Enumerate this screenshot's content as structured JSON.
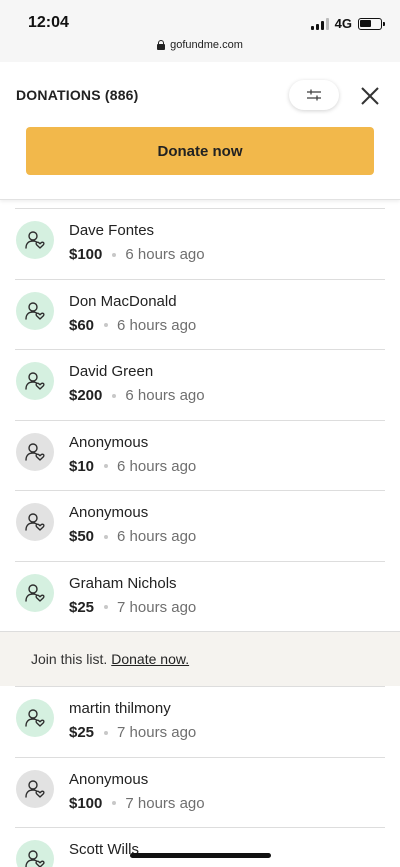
{
  "status_bar": {
    "time": "12:04",
    "network": "4G",
    "url": "gofundme.com",
    "icons": [
      "signal-icon",
      "battery-icon",
      "lock-icon"
    ]
  },
  "header": {
    "title": "DONATIONS (886)",
    "filter_icon": "sliders-icon",
    "close_icon": "close-icon",
    "donate_label": "Donate now"
  },
  "colors": {
    "donate_button": "#f2b84b",
    "avatar_green": "#d5f0e0",
    "avatar_grey": "#e2e2e2",
    "banner_bg": "#f5f3ef"
  },
  "donations": [
    {
      "name": "Dave Fontes",
      "amount": "$100",
      "time": "6 hours ago",
      "avatar": "green"
    },
    {
      "name": "Don MacDonald",
      "amount": "$60",
      "time": "6 hours ago",
      "avatar": "green"
    },
    {
      "name": "David Green",
      "amount": "$200",
      "time": "6 hours ago",
      "avatar": "green"
    },
    {
      "name": "Anonymous",
      "amount": "$10",
      "time": "6 hours ago",
      "avatar": "grey"
    },
    {
      "name": "Anonymous",
      "amount": "$50",
      "time": "6 hours ago",
      "avatar": "grey"
    },
    {
      "name": "Graham Nichols",
      "amount": "$25",
      "time": "7 hours ago",
      "avatar": "green"
    }
  ],
  "join_banner": {
    "text": "Join this list.",
    "link": "Donate now."
  },
  "donations_after": [
    {
      "name": "martin thilmony",
      "amount": "$25",
      "time": "7 hours ago",
      "avatar": "green"
    },
    {
      "name": "Anonymous",
      "amount": "$100",
      "time": "7 hours ago",
      "avatar": "grey"
    },
    {
      "name": "Scott Wills",
      "amount": "",
      "time": "",
      "avatar": "green"
    }
  ]
}
